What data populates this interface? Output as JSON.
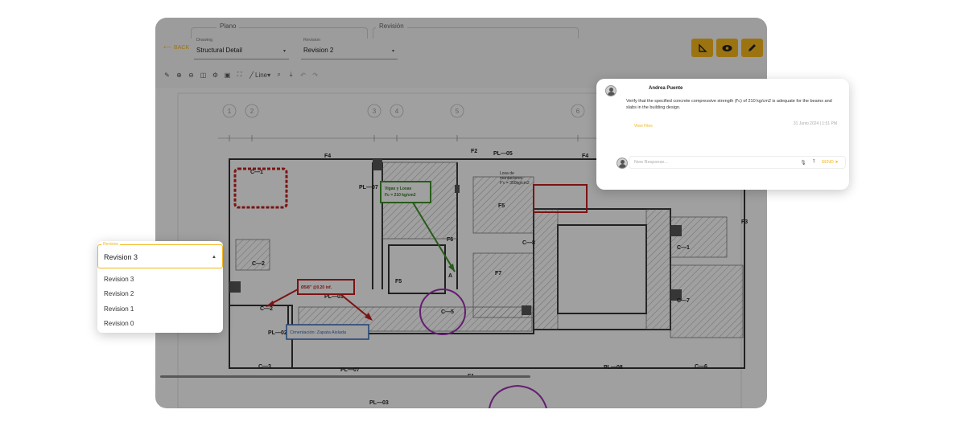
{
  "header": {
    "group_plano": "Plano",
    "group_revision": "Revisión",
    "back_label": "BACK",
    "drawing_select": {
      "label": "Drawing",
      "value": "Structural Detail"
    },
    "revision_select": {
      "label": "Revision",
      "value": "Revision 2"
    }
  },
  "toolbar": {
    "line_label": "Line"
  },
  "colors": {
    "accent": "#f2b61c"
  },
  "drawing": {
    "callout_green": [
      "Vigas y Losas",
      "Fc = 210 kg/cm2"
    ],
    "callout_red": "Ø5/8\" @0.20 inf.",
    "callout_blue": "Cimentación: Zapata Aislada",
    "note_losa": [
      "Losa de",
      "mantaciones",
      "F'c = 350kg/cm2"
    ],
    "labels": {
      "pl05": "PL—05",
      "pl07": "PL—07",
      "pl03": "PL—03",
      "pl03b": "PL—03",
      "pl02": "PL—02",
      "pl07b": "PL—07",
      "pl08": "PL—08",
      "c1": "C—1",
      "c2": "C—2",
      "c2b": "C—2",
      "c3": "C—3",
      "c5": "C—5",
      "c8": "C—8",
      "c7": "C—7",
      "c1b": "C—1",
      "c4": "C—4",
      "c6": "C—6",
      "f2": "F2",
      "f4": "F4",
      "f5": "F5",
      "f5b": "F5",
      "f6": "F6",
      "f7": "F7",
      "f3": "F3",
      "f1": "F1",
      "f4b": "F4",
      "a": "A"
    },
    "grid_numbers": [
      "1",
      "2",
      "3",
      "4",
      "5",
      "6",
      "7",
      "8"
    ]
  },
  "comment": {
    "author": "Andrea Puente",
    "text": "Verify that the specified concrete compressive strength (f'c) of 210 kg/cm2 is adequate for the beams and slabs in the building design.",
    "link": "View Files",
    "time": "31 Junio 2024 | 1:51 PM",
    "input_placeholder": "New Response...",
    "send_label": "SEND"
  },
  "revision_dropdown": {
    "label": "Revision",
    "value": "Revision 3",
    "options": [
      "Revision 3",
      "Revision 2",
      "Revision 1",
      "Revision 0"
    ]
  }
}
